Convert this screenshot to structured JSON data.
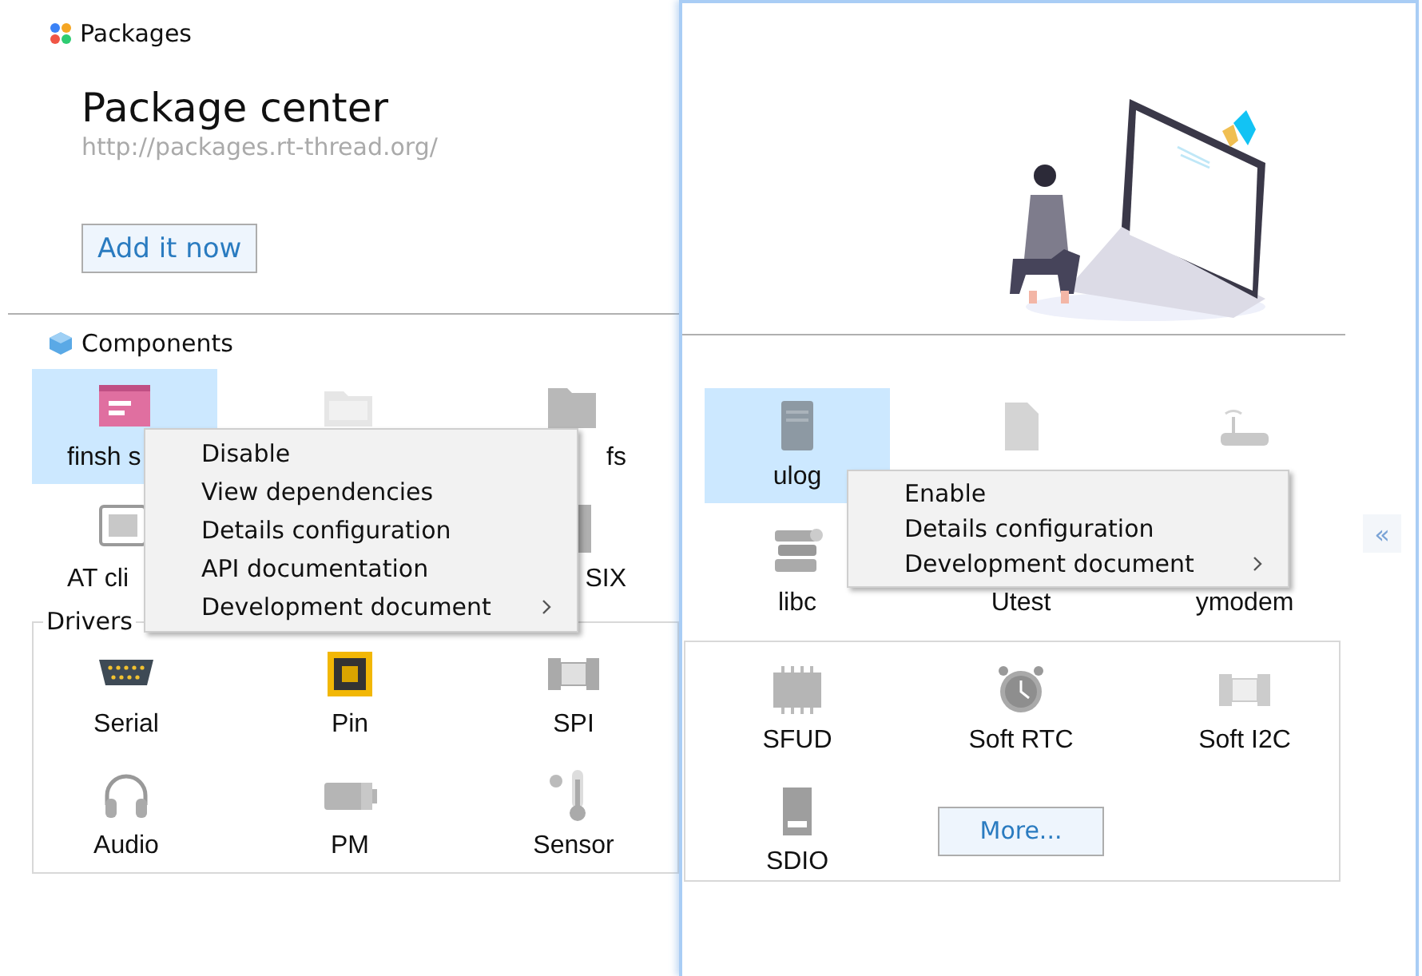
{
  "left_window": {
    "title": "Packages",
    "heading": "Package center",
    "url": "http://packages.rt-thread.org/",
    "add_button": "Add it now",
    "components": {
      "title": "Components",
      "items": [
        {
          "kind": "terminal",
          "label": "finsh s",
          "selected": true
        },
        {
          "kind": "folder",
          "selected": false
        },
        {
          "kind": "fat",
          "label": "fs",
          "selected": false
        },
        {
          "kind": "at",
          "label": "AT cli",
          "selected": false
        },
        {
          "kind": "none"
        },
        {
          "kind": "posix",
          "label": "SIX",
          "selected": false
        }
      ]
    },
    "drivers": {
      "title": "Drivers",
      "items": [
        {
          "kind": "serial",
          "label": "Serial"
        },
        {
          "kind": "chip",
          "label": "Pin"
        },
        {
          "kind": "spi",
          "label": "SPI"
        },
        {
          "kind": "headphones",
          "label": "Audio"
        },
        {
          "kind": "battery",
          "label": "PM"
        },
        {
          "kind": "thermometer",
          "label": "Sensor"
        }
      ]
    },
    "context_menu": [
      {
        "label": "Disable",
        "submenu": false
      },
      {
        "label": "View dependencies",
        "submenu": false
      },
      {
        "label": "Details configuration",
        "submenu": false
      },
      {
        "label": "API documentation",
        "submenu": false
      },
      {
        "label": "Development document",
        "submenu": true
      }
    ]
  },
  "right_window": {
    "collapse_button": "«",
    "components": [
      {
        "kind": "log",
        "label": "ulog",
        "selected": true
      },
      {
        "kind": "cpp",
        "selected": false
      },
      {
        "kind": "router",
        "selected": false
      },
      {
        "kind": "books",
        "label": "libc",
        "selected": false
      },
      {
        "kind": "none",
        "label": "Utest",
        "selected": false
      },
      {
        "kind": "none",
        "label": "ymodem",
        "selected": false
      }
    ],
    "drivers": [
      {
        "kind": "flash",
        "label": "SFUD"
      },
      {
        "kind": "clock",
        "label": "Soft RTC"
      },
      {
        "kind": "i2c",
        "label": "Soft I2C"
      },
      {
        "kind": "sdcard",
        "label": "SDIO"
      }
    ],
    "more_button": "More...",
    "context_menu": [
      {
        "label": "Enable",
        "submenu": false
      },
      {
        "label": "Details configuration",
        "submenu": false
      },
      {
        "label": "Development document",
        "submenu": true
      }
    ]
  }
}
